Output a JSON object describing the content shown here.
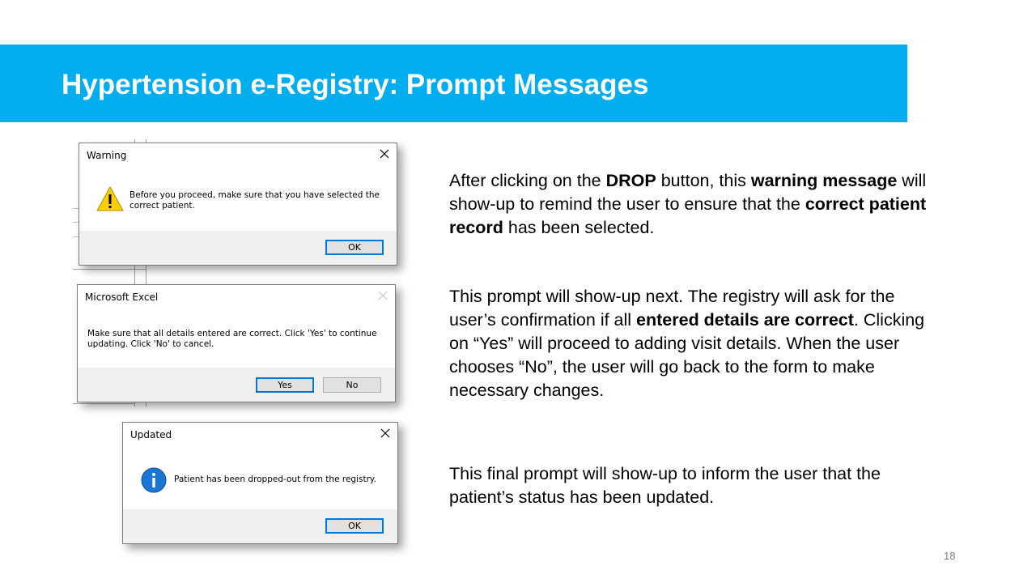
{
  "slide": {
    "title": "Hypertension e-Registry: Prompt Messages",
    "page_number": "18",
    "banner_color": "#00aeef"
  },
  "dialogs": {
    "warning": {
      "title": "Warning",
      "message_line1": "Before you proceed, make sure that you have selected the",
      "message_line2": "correct patient.",
      "ok_label": "OK",
      "icon": "warning-triangle-icon"
    },
    "excel": {
      "title": "Microsoft Excel",
      "message_line1": "Make sure that all details entered are correct. Click 'Yes' to continue",
      "message_line2": "updating. Click 'No' to cancel.",
      "yes_label": "Yes",
      "no_label": "No"
    },
    "updated": {
      "title": "Updated",
      "message": "Patient has been dropped-out from the registry.",
      "ok_label": "OK",
      "icon": "info-circle-icon"
    }
  },
  "paragraphs": {
    "p1": {
      "a": "After clicking on the ",
      "b": "DROP",
      "c": " button, this ",
      "d": "warning message",
      "e": " will show-up to remind the user to ensure that the ",
      "f": "correct patient record",
      "g": " has been selected."
    },
    "p2": {
      "a": "This prompt will show-up next. The registry will ask for the user’s confirmation if all ",
      "b": "entered details are correct",
      "c": ". Clicking on “Yes” will proceed to adding visit details. When the user chooses “No”, the user will go back to the form to make necessary changes."
    },
    "p3": {
      "a": "This final prompt will show-up to inform the user that the patient’s status has been updated."
    }
  }
}
